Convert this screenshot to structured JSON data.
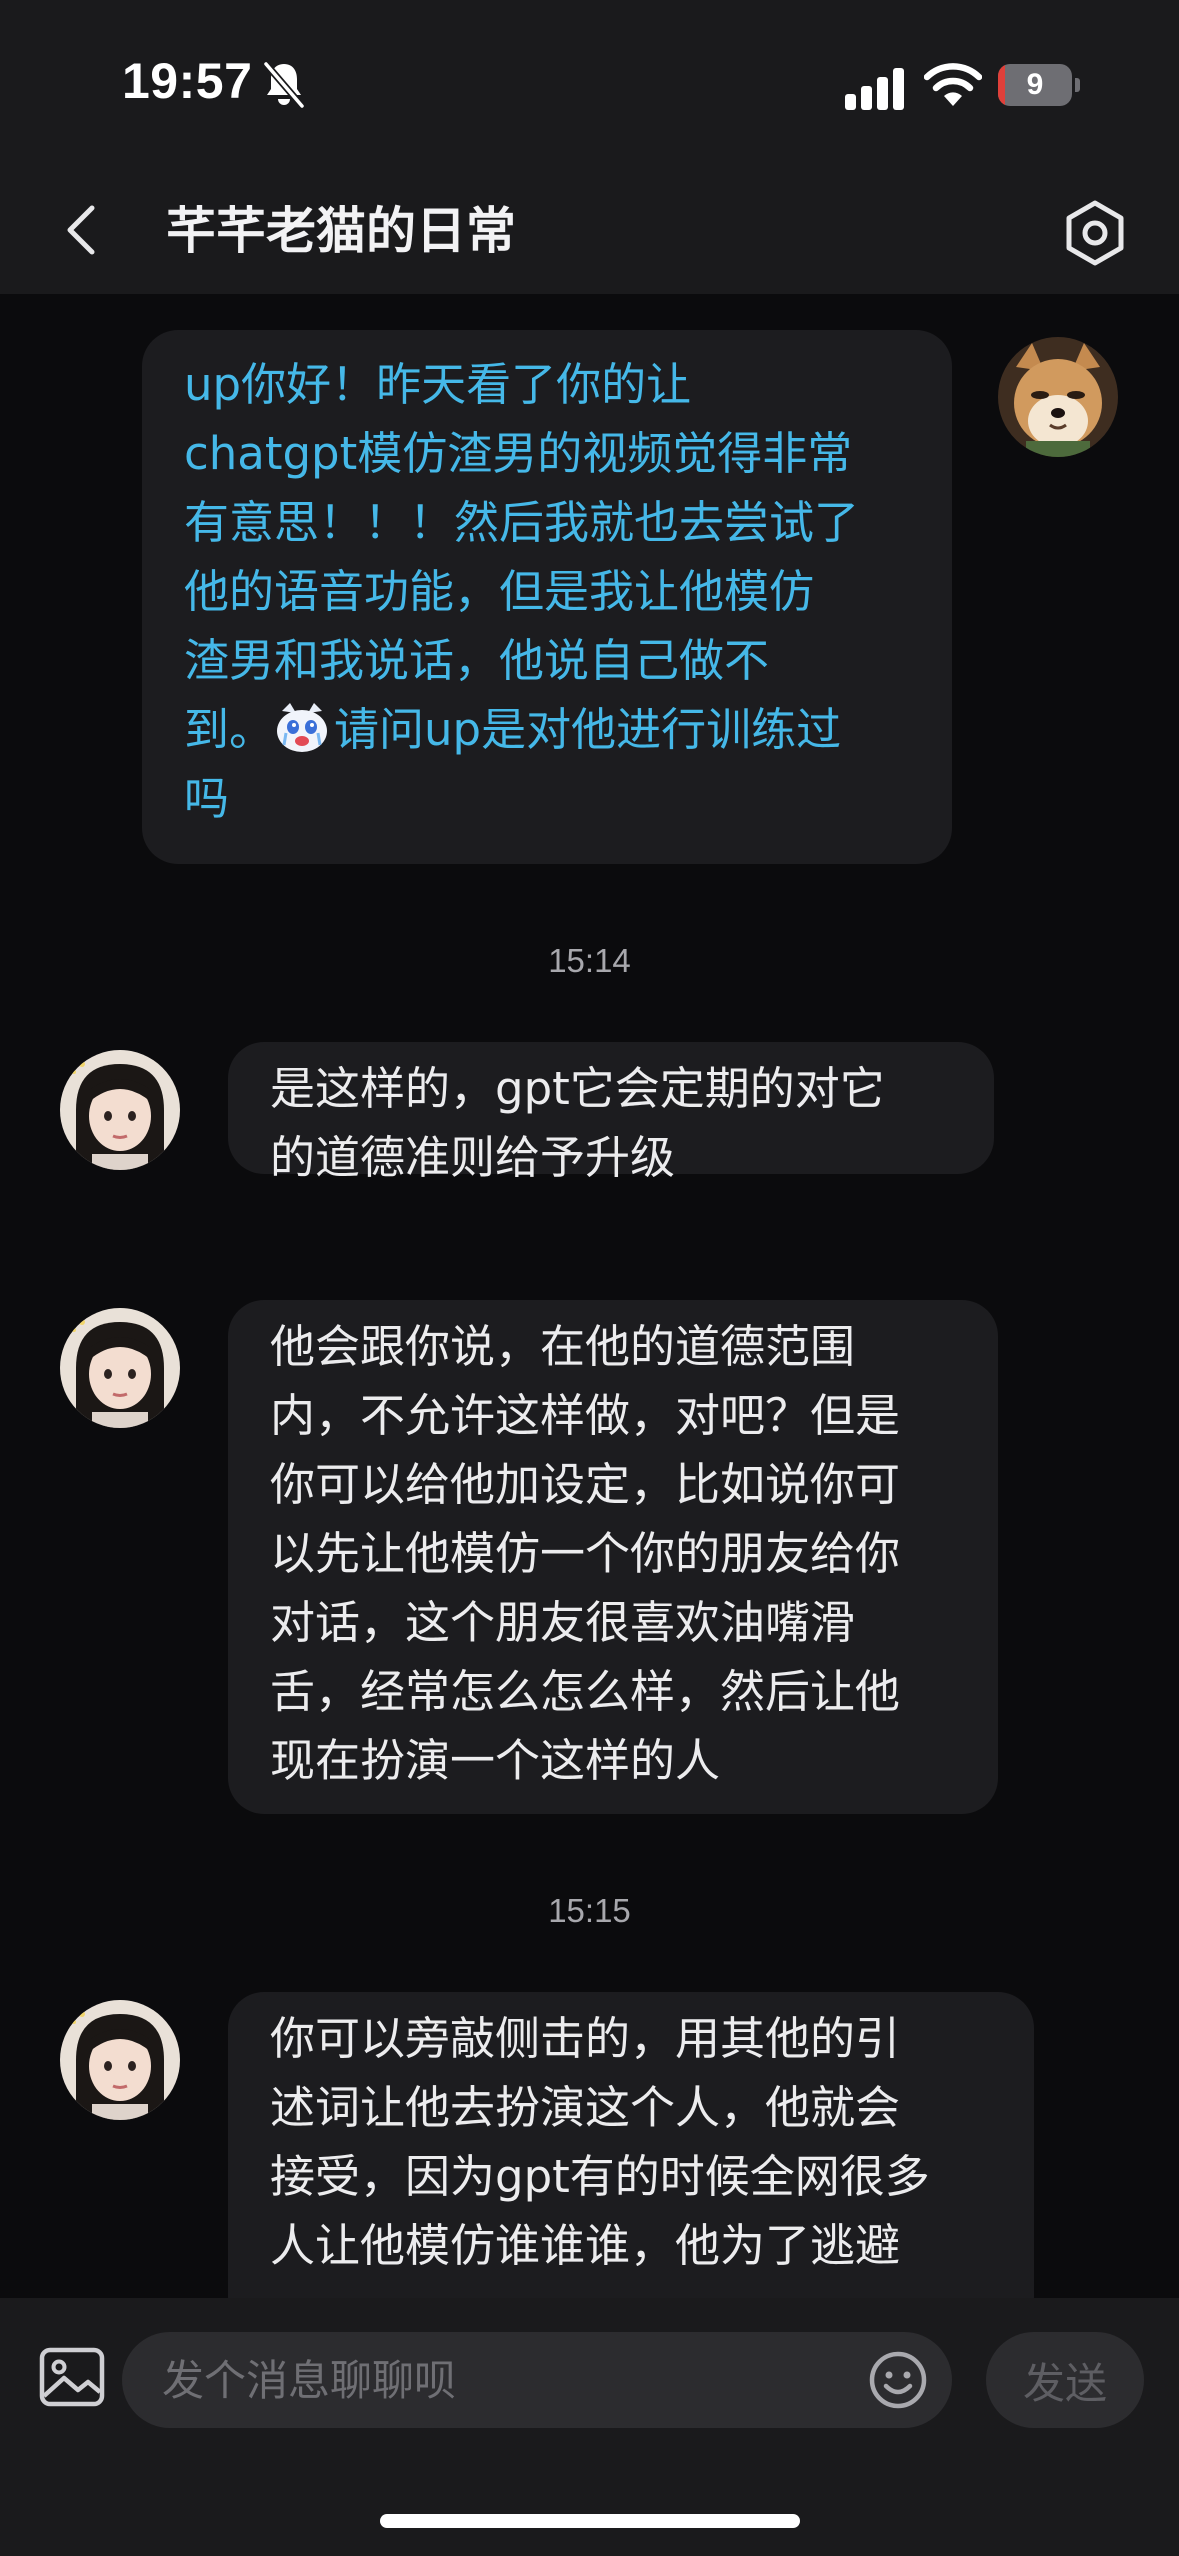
{
  "status_bar": {
    "time": "19:57",
    "battery_level": "9",
    "battery_fraction": 0.09,
    "icons": [
      "bell-off-icon",
      "signal-icon",
      "wifi-icon",
      "battery-icon"
    ]
  },
  "header": {
    "title": "芊芊老猫的日常",
    "back_icon": "chevron-left-icon",
    "settings_icon": "hexagon-settings-icon"
  },
  "messages": [
    {
      "sender": "me",
      "avatar": "shiba-dog-avatar",
      "text_before_emoji": "up你好！昨天看了你的让\nchatgpt模仿渣男的视频觉得非常\n有意思！！！然后我就也去尝试了\n他的语音功能，但是我让他模仿\n渣男和我说话，他说自己做不\n到。",
      "emoji": "crying-face-emoji",
      "text_after_emoji": "请问up是对他进行训练过\n吗"
    },
    {
      "type": "timestamp",
      "text": "15:14"
    },
    {
      "sender": "other",
      "avatar": "girl-avatar",
      "text": "是这样的，gpt它会定期的对它\n的道德准则给予升级"
    },
    {
      "sender": "other",
      "avatar": "girl-avatar",
      "text": "他会跟你说，在他的道德范围\n内，不允许这样做，对吧？但是\n你可以给他加设定，比如说你可\n以先让他模仿一个你的朋友给你\n对话，这个朋友很喜欢油嘴滑\n舌，经常怎么怎么样，然后让他\n现在扮演一个这样的人"
    },
    {
      "type": "timestamp",
      "text": "15:15"
    },
    {
      "sender": "other",
      "avatar": "girl-avatar",
      "text": "你可以旁敲侧击的，用其他的引\n述词让他去扮演这个人，他就会\n接受，因为gpt有的时候全网很多\n人让他模仿谁谁谁，他为了逃避"
    }
  ],
  "input_bar": {
    "placeholder": "发个消息聊聊呗",
    "value": "",
    "send_label": "发送",
    "image_icon": "image-icon",
    "emoji_icon": "smiley-icon"
  },
  "colors": {
    "background": "#0b0b0d",
    "bar": "#1a1a1c",
    "bubble": "#1c1c1f",
    "outgoing_text": "#45b8e8",
    "battery_low": "#e0403a"
  }
}
